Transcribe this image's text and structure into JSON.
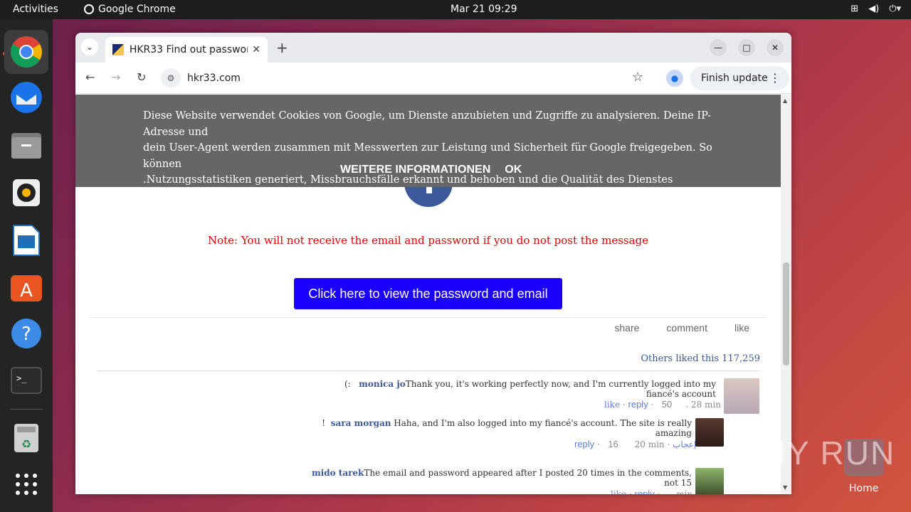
{
  "topbar": {
    "activities": "Activities",
    "app_name": "Google Chrome",
    "clock": "Mar 21  09:29"
  },
  "dock": {
    "items": [
      "chrome-icon",
      "thunderbird-icon",
      "files-icon",
      "rhythmbox-icon",
      "writer-icon",
      "app-center-icon",
      "help-icon",
      "terminal-icon",
      "trash-icon",
      "apps-grid-icon"
    ]
  },
  "browser": {
    "tab_title": "HKR33 Find out passwor",
    "url": "hkr33.com",
    "finish_update": "Finish update"
  },
  "cookie_banner": {
    "line1": "Diese Website verwendet Cookies von Google, um Dienste anzubieten und Zugriffe zu analysieren. Deine IP-Adresse und",
    "line2": "dein User-Agent werden zusammen mit Messwerten zur Leistung und Sicherheit für Google freigegeben. So können",
    "line3": ".Nutzungsstatistiken generiert, Missbrauchsfälle erkannt und behoben und die Qualität des Dienstes gewährleistet werden",
    "more_info": "WEITERE INFORMATIONEN",
    "ok": "OK"
  },
  "page": {
    "note": "Note: You will not receive the email and password if you do not post the message",
    "cta": "Click here to view the password and email",
    "actions": {
      "share": "share",
      "comment": "comment",
      "like": "like"
    },
    "likes_text": "Others liked this 117,259",
    "comments": [
      {
        "name": "monica jo",
        "text": "Thank you, it's working perfectly now, and I'm currently logged into my fiancé's account",
        "prefix": "(:",
        "like": "like",
        "reply": "reply",
        "count": "50",
        "time": ". 28 min"
      },
      {
        "name": "sara morgan",
        "text": " Haha, and I'm also logged into my fiancé's account. The site is really amazing",
        "prefix": "!",
        "reply": "reply",
        "count": "16",
        "time": "20 min",
        "like_ar": "إعجاب"
      },
      {
        "name": "mido tarek",
        "text": "The email and password appeared after I posted 20 times in the comments, not 15",
        "like": "like",
        "reply": "reply",
        "time": "min"
      }
    ]
  },
  "desktop": {
    "watermark": "ANY RUN",
    "home_label": "Home"
  }
}
